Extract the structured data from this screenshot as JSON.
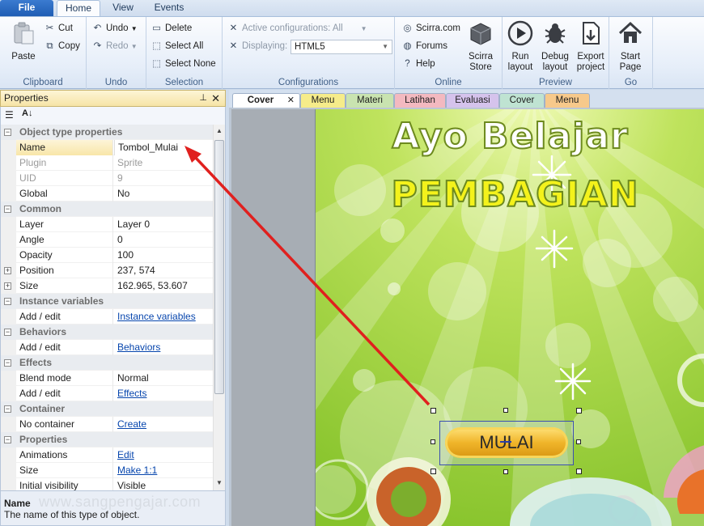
{
  "ribbon": {
    "file_tab": "File",
    "tabs": [
      {
        "label": "Home"
      },
      {
        "label": "View"
      },
      {
        "label": "Events"
      }
    ],
    "clipboard": {
      "paste": "Paste",
      "cut": "Cut",
      "copy": "Copy",
      "group": "Clipboard"
    },
    "undo": {
      "undo": "Undo",
      "redo": "Redo",
      "group": "Undo"
    },
    "selection": {
      "delete": "Delete",
      "select_all": "Select All",
      "select_none": "Select None",
      "group": "Selection"
    },
    "configurations": {
      "active": "Active configurations: All",
      "displaying_label": "Displaying:",
      "displaying_value": "HTML5",
      "group": "Configurations"
    },
    "online": {
      "scirra": "Scirra.com",
      "forums": "Forums",
      "help": "Help",
      "store_line1": "Scirra",
      "store_line2": "Store",
      "group": "Online"
    },
    "preview": {
      "run_line1": "Run",
      "run_line2": "layout",
      "debug_line1": "Debug",
      "debug_line2": "layout",
      "export_line1": "Export",
      "export_line2": "project",
      "group": "Preview"
    },
    "go": {
      "start_line1": "Start",
      "start_line2": "Page",
      "group": "Go"
    }
  },
  "properties": {
    "title": "Properties",
    "rows": [
      {
        "type": "cat",
        "label": "Object type properties",
        "toggle": "−"
      },
      {
        "label": "Name",
        "value": "Tombol_Mulai"
      },
      {
        "label": "Plugin",
        "value": "Sprite"
      },
      {
        "label": "UID",
        "value": "9"
      },
      {
        "label": "Global",
        "value": "No"
      },
      {
        "type": "cat",
        "label": "Common",
        "toggle": "−"
      },
      {
        "label": "Layer",
        "value": "Layer 0"
      },
      {
        "label": "Angle",
        "value": "0"
      },
      {
        "label": "Opacity",
        "value": "100"
      },
      {
        "label": "Position",
        "value": "237, 574",
        "toggle": "+"
      },
      {
        "label": "Size",
        "value": "162.965, 53.607",
        "toggle": "+"
      },
      {
        "type": "cat",
        "label": "Instance variables",
        "toggle": "−"
      },
      {
        "label": "Add / edit",
        "value": "Instance variables",
        "link": true
      },
      {
        "type": "cat",
        "label": "Behaviors",
        "toggle": "−"
      },
      {
        "label": "Add / edit",
        "value": "Behaviors",
        "link": true
      },
      {
        "type": "cat",
        "label": "Effects",
        "toggle": "−"
      },
      {
        "label": "Blend mode",
        "value": "Normal"
      },
      {
        "label": "Add / edit",
        "value": "Effects",
        "link": true
      },
      {
        "type": "cat",
        "label": "Container",
        "toggle": "−"
      },
      {
        "label": "No container",
        "value": "Create",
        "link": true
      },
      {
        "type": "cat",
        "label": "Properties",
        "toggle": "−"
      },
      {
        "label": "Animations",
        "value": "Edit",
        "link": true
      },
      {
        "label": "Size",
        "value": "Make 1:1",
        "link": true
      },
      {
        "label": "Initial visibility",
        "value": "Visible"
      }
    ],
    "desc_title": "Name",
    "desc_text": "The name of this type of object."
  },
  "doc_tabs": [
    {
      "label": "Cover",
      "color": "#ffffff",
      "active": true
    },
    {
      "label": "Menu",
      "color": "#f6ec8a"
    },
    {
      "label": "Materi",
      "color": "#c9e3b0"
    },
    {
      "label": "Latihan",
      "color": "#f3b9c0"
    },
    {
      "label": "Evaluasi",
      "color": "#d5c3ec"
    },
    {
      "label": "Cover",
      "color": "#bfe3d2"
    },
    {
      "label": "Menu",
      "color": "#f7c98b"
    }
  ],
  "scene": {
    "title_line1": "Ayo Belajar",
    "title_line2": "PEMBAGIAN",
    "button_label": "MULAI"
  },
  "watermark": "www.sangpengajar.com",
  "colors": {
    "arrow": "#e0201e",
    "title_fill": "#ffffff",
    "title2_fill": "#f4f21b",
    "background_green": "#9bd23a"
  }
}
